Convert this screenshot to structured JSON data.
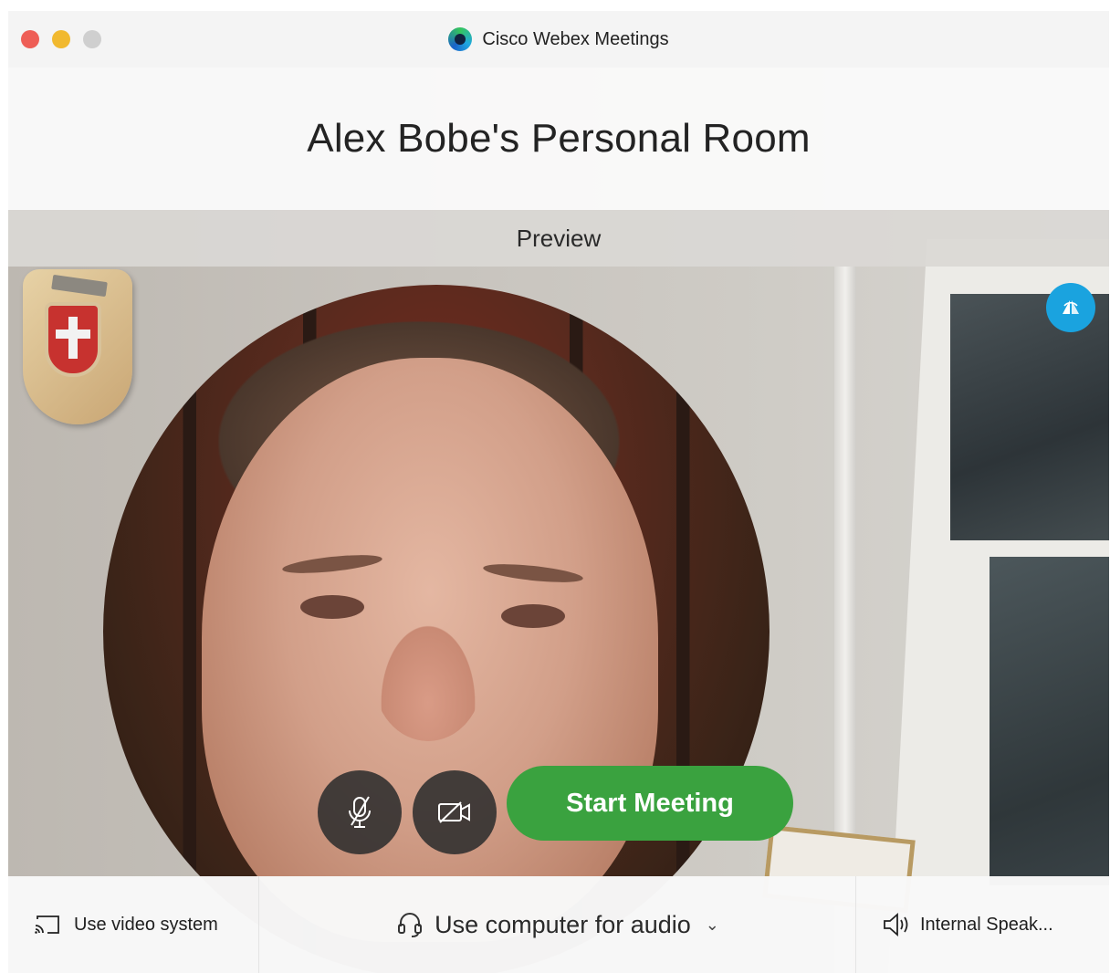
{
  "window": {
    "app_title": "Cisco Webex Meetings",
    "app_icon": "webex-logo-icon"
  },
  "header": {
    "room_title": "Alex Bobe's Personal Room",
    "preview_label": "Preview"
  },
  "preview": {
    "flip_icon": "self-view-flip-icon",
    "mute_icon": "microphone-muted-icon",
    "video_icon": "video-off-icon",
    "start_button_label": "Start Meeting"
  },
  "bottom_bar": {
    "video_system_label": "Use video system",
    "audio_label": "Use computer for audio",
    "audio_chevron": "⌄",
    "speaker_label": "Internal Speak..."
  },
  "colors": {
    "start_button": "#3aa23f",
    "flip_button": "#1aa3df",
    "close": "#ee5e56",
    "minimize": "#f1b92f",
    "maximize": "#cfcfcf"
  }
}
